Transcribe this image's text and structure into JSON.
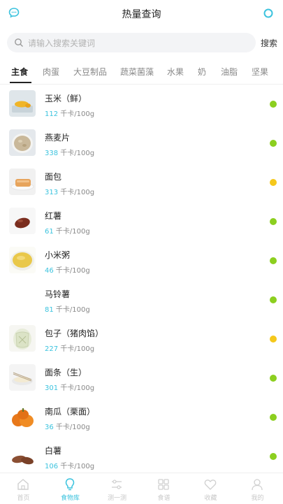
{
  "header": {
    "title": "热量查询",
    "left_icon": "chat-bubble-icon",
    "right_icon": "circle-icon"
  },
  "search": {
    "placeholder": "请输入搜索关键词",
    "value": "",
    "button_label": "搜索"
  },
  "tabs": [
    {
      "label": "主食",
      "active": true
    },
    {
      "label": "肉蛋",
      "active": false
    },
    {
      "label": "大豆制品",
      "active": false
    },
    {
      "label": "蔬菜菌藻",
      "active": false
    },
    {
      "label": "水果",
      "active": false
    },
    {
      "label": "奶",
      "active": false
    },
    {
      "label": "油脂",
      "active": false
    },
    {
      "label": "坚果",
      "active": false
    }
  ],
  "foods": [
    {
      "name": "玉米（鲜）",
      "kcal": "112",
      "unit": "千卡/100g",
      "level": "green",
      "image": "corn"
    },
    {
      "name": "燕麦片",
      "kcal": "338",
      "unit": "千卡/100g",
      "level": "green",
      "image": "oats"
    },
    {
      "name": "面包",
      "kcal": "313",
      "unit": "千卡/100g",
      "level": "yellow",
      "image": "bread"
    },
    {
      "name": "红薯",
      "kcal": "61",
      "unit": "千卡/100g",
      "level": "green",
      "image": "sweet-potato"
    },
    {
      "name": "小米粥",
      "kcal": "46",
      "unit": "千卡/100g",
      "level": "green",
      "image": "millet-porridge"
    },
    {
      "name": "马铃薯",
      "kcal": "81",
      "unit": "千卡/100g",
      "level": "green",
      "image": "none"
    },
    {
      "name": "包子（猪肉馅）",
      "kcal": "227",
      "unit": "千卡/100g",
      "level": "yellow",
      "image": "bun"
    },
    {
      "name": "面条（生）",
      "kcal": "301",
      "unit": "千卡/100g",
      "level": "green",
      "image": "noodles"
    },
    {
      "name": "南瓜（栗面）",
      "kcal": "36",
      "unit": "千卡/100g",
      "level": "green",
      "image": "pumpkin"
    },
    {
      "name": "白薯",
      "kcal": "106",
      "unit": "千卡/100g",
      "level": "green",
      "image": "white-yam"
    }
  ],
  "colors": {
    "accent": "#3cc3de",
    "green": "#8ccf1f",
    "yellow": "#f5c81b"
  },
  "bottom_nav": [
    {
      "label": "首页",
      "icon": "home-icon",
      "active": false
    },
    {
      "label": "食物库",
      "icon": "bulb-icon",
      "active": true
    },
    {
      "label": "测一测",
      "icon": "sliders-icon",
      "active": false
    },
    {
      "label": "食谱",
      "icon": "grid-icon",
      "active": false
    },
    {
      "label": "收藏",
      "icon": "heart-icon",
      "active": false
    },
    {
      "label": "我的",
      "icon": "user-icon",
      "active": false
    }
  ]
}
